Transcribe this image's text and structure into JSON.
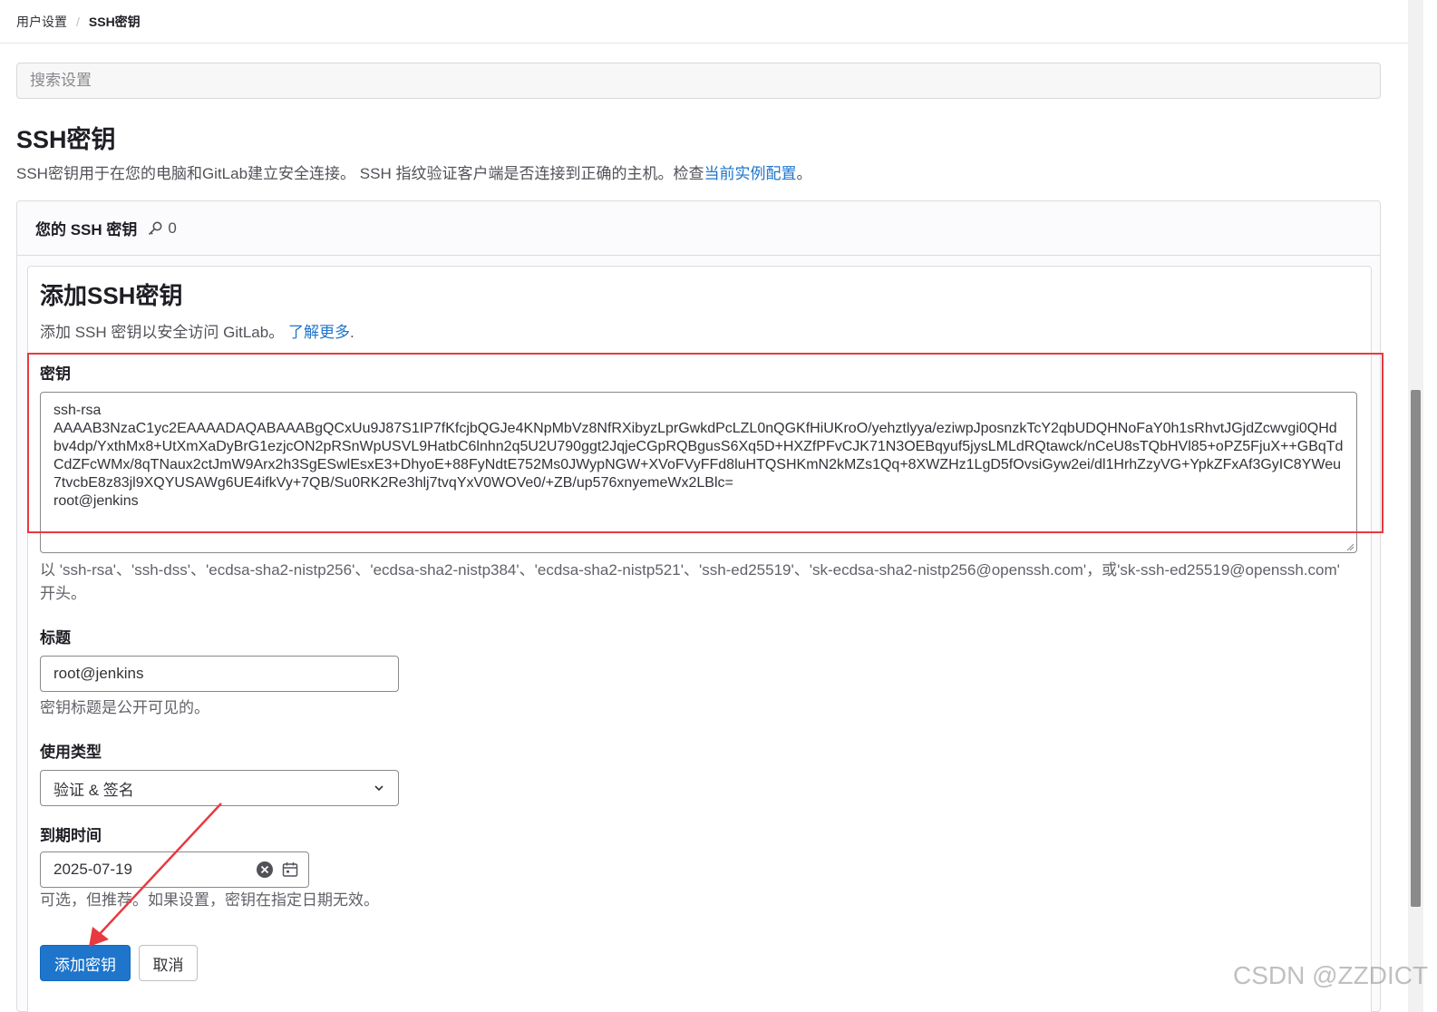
{
  "breadcrumb": {
    "parent": "用户设置",
    "separator": "/",
    "current": "SSH密钥"
  },
  "search": {
    "placeholder": "搜索设置"
  },
  "page": {
    "title": "SSH密钥",
    "description": "SSH密钥用于在您的电脑和GitLab建立安全连接。 SSH 指纹验证客户端是否连接到正确的主机。检查",
    "description_link": "当前实例配置",
    "description_end": "。"
  },
  "keys_card": {
    "title": "您的 SSH 密钥",
    "count": "0",
    "icon": "key-icon"
  },
  "form": {
    "title": "添加SSH密钥",
    "description": "添加 SSH 密钥以安全访问 GitLab。",
    "learn_more": "了解更多",
    "description_end": ".",
    "key_label": "密钥",
    "key_value": "ssh-rsa\nAAAAB3NzaC1yc2EAAAADAQABAAABgQCxUu9J87S1IP7fKfcjbQGJe4KNpMbVz8NfRXibyzLprGwkdPcLZL0nQGKfHiUKroO/yehztlyya/eziwpJposnzkTcY2qbUDQHNoFaY0h1sRhvtJGjdZcwvgi0QHdbv4dp/YxthMx8+UtXmXaDyBrG1ezjcON2pRSnWpUSVL9HatbC6lnhn2q5U2U790ggt2JqjeCGpRQBgusS6Xq5D+HXZfPFvCJK71N3OEBqyuf5jysLMLdRQtawck/nCeU8sTQbHVl85+oPZ5FjuX++GBqTdCdZFcWMx/8qTNaux2ctJmW9Arx2h3SgESwlEsxE3+DhyoE+88FyNdtE752Ms0JWypNGW+XVoFVyFFd8luHTQSHKmN2kMZs1Qq+8XWZHz1LgD5fOvsiGyw2ei/dl1HrhZzyVG+YpkZFxAf3GyIC8YWeu7tvcbE8z83jl9XQYUSAWg6UE4ifkVy+7QB/Su0RK2Re3hlj7tvqYxV0WOVe0/+ZB/up576xnyemeWx2LBlc=\nroot@jenkins",
    "key_help": "以 'ssh-rsa'、'ssh-dss'、'ecdsa-sha2-nistp256'、'ecdsa-sha2-nistp384'、'ecdsa-sha2-nistp521'、'ssh-ed25519'、'sk-ecdsa-sha2-nistp256@openssh.com'，或'sk-ssh-ed25519@openssh.com' 开头。",
    "title_label": "标题",
    "title_value": "root@jenkins",
    "title_help": "密钥标题是公开可见的。",
    "usage_label": "使用类型",
    "usage_value": "验证 & 签名",
    "expiry_label": "到期时间",
    "expiry_value": "2025-07-19",
    "expiry_help": "可选，但推荐。如果设置，密钥在指定日期无效。",
    "submit_button": "添加密钥",
    "cancel_button": "取消"
  },
  "watermark": "CSDN @ZZDICT",
  "colors": {
    "primary": "#1f75cb",
    "link": "#1f75cb",
    "annotation": "#e8393f"
  }
}
